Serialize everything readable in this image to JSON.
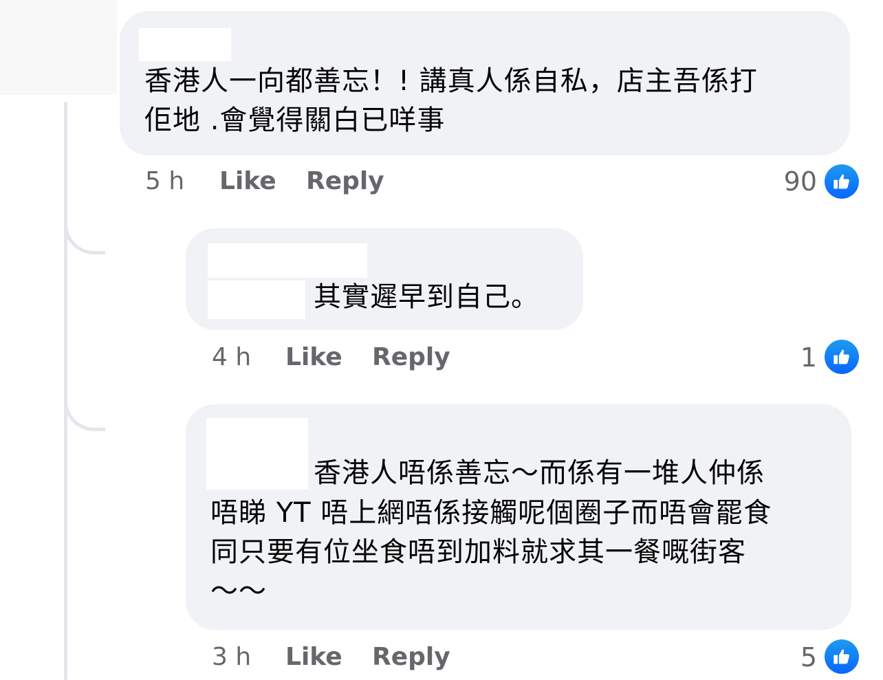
{
  "comments": [
    {
      "text": "香港人一向都善忘！! 講真人係自私，店主吾係打\n佢地 .會覺得關白已咩事",
      "time": "5 h",
      "like_label": "Like",
      "reply_label": "Reply",
      "reaction_count": "90",
      "reaction_icon": "thumbs-up-icon"
    },
    {
      "text": "其實遲早到自己。",
      "time": "4 h",
      "like_label": "Like",
      "reply_label": "Reply",
      "reaction_count": "1",
      "reaction_icon": "thumbs-up-icon"
    },
    {
      "text_line1": "香港人唔係善忘～而係有一堆人仲係",
      "text_rest": "唔睇 YT 唔上網唔係接觸呢個圈子而唔會罷食\n同只要有位坐食唔到加料就求其一餐嘅街客\n～～",
      "time": "3 h",
      "like_label": "Like",
      "reply_label": "Reply",
      "reaction_count": "5",
      "reaction_icon": "thumbs-up-icon"
    }
  ],
  "colors": {
    "bubble": "#f0f2f5",
    "meta_text": "#65676b",
    "like_blue": "#0866ff",
    "thread_line": "#e4e6eb"
  }
}
